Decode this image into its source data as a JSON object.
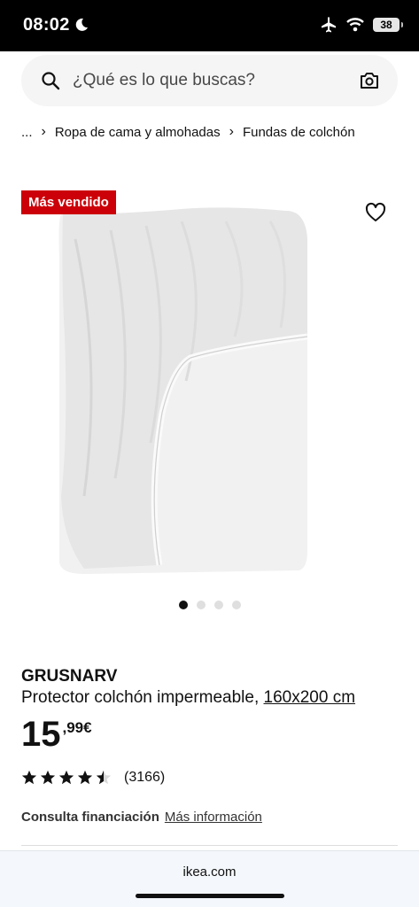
{
  "status_bar": {
    "time": "08:02",
    "battery": "38"
  },
  "search": {
    "placeholder": "¿Qué es lo que buscas?"
  },
  "breadcrumb": {
    "ellipsis": "...",
    "separator": "›",
    "items": [
      "Ropa de cama y almohadas",
      "Fundas de colchón"
    ]
  },
  "product": {
    "badge": "Más vendido",
    "name": "GRUSNARV",
    "description": "Protector colchón impermeable, ",
    "size": "160x200 cm",
    "price_int": "15",
    "price_dec": ",99€",
    "rating": 4.5,
    "reviews": "(3166)"
  },
  "carousel": {
    "count": 4,
    "active": 1
  },
  "finance": {
    "label": "Consulta financiación",
    "link": "Más información"
  },
  "browser": {
    "url": "ikea.com"
  },
  "colors": {
    "badge": "#cc0008",
    "search_bg": "#f5f5f5"
  },
  "icons": [
    "moon-icon",
    "airplane-icon",
    "wifi-icon",
    "battery-icon",
    "search-icon",
    "camera-icon",
    "heart-icon",
    "star-icon"
  ]
}
